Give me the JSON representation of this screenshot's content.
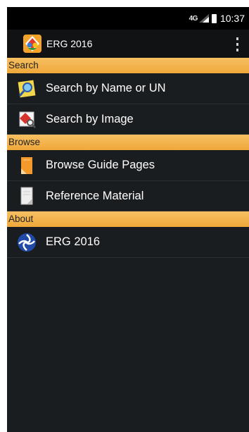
{
  "status_bar": {
    "network": "4G",
    "time": "10:37"
  },
  "action_bar": {
    "title": "ERG 2016",
    "logo_icon": "erg-logo-icon",
    "overflow_icon": "overflow-menu-icon"
  },
  "sections": [
    {
      "header": "Search",
      "items": [
        {
          "label": "Search by Name or UN",
          "icon": "search-name-icon"
        },
        {
          "label": "Search by Image",
          "icon": "search-image-icon"
        }
      ]
    },
    {
      "header": "Browse",
      "items": [
        {
          "label": "Browse Guide Pages",
          "icon": "guide-pages-icon"
        },
        {
          "label": "Reference Material",
          "icon": "reference-material-icon"
        }
      ]
    },
    {
      "header": "About",
      "items": [
        {
          "label": "ERG 2016",
          "icon": "dot-logo-icon"
        }
      ]
    }
  ],
  "colors": {
    "section_header": "#f0a83a",
    "background": "#1a1d20",
    "action_bar": "#111214",
    "status_bar": "#000000"
  }
}
